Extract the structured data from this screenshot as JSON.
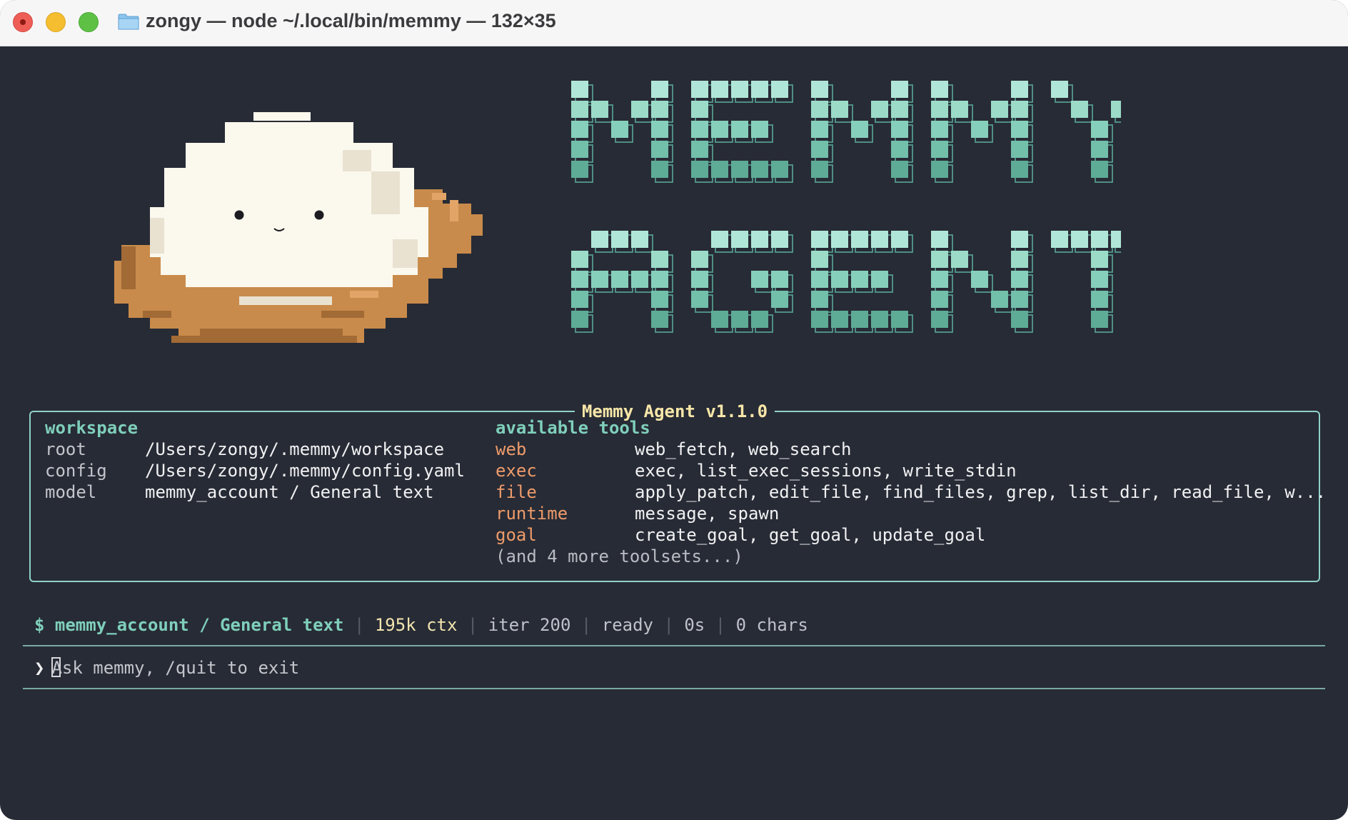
{
  "window": {
    "title": "zongy — node ~/.local/bin/memmy — 132×35"
  },
  "banner": {
    "logo_line_1": "MEMMY",
    "logo_line_2": "AGENT",
    "logo_color": "#9ee0cd"
  },
  "info_panel": {
    "title": "Memmy Agent v1.1.0",
    "workspace": {
      "heading": "workspace",
      "rows": [
        {
          "label": "root",
          "value": "/Users/zongy/.memmy/workspace"
        },
        {
          "label": "config",
          "value": "/Users/zongy/.memmy/config.yaml"
        },
        {
          "label": "model",
          "value": "memmy_account / General text"
        }
      ]
    },
    "tools": {
      "heading": "available tools",
      "rows": [
        {
          "category": "web",
          "tools": "web_fetch, web_search"
        },
        {
          "category": "exec",
          "tools": "exec, list_exec_sessions, write_stdin"
        },
        {
          "category": "file",
          "tools": "apply_patch, edit_file, find_files, grep, list_dir, read_file, w..."
        },
        {
          "category": "runtime",
          "tools": "message, spawn"
        },
        {
          "category": "goal",
          "tools": "create_goal, get_goal, update_goal"
        }
      ],
      "more": "(and 4 more toolsets...)"
    }
  },
  "status_bar": {
    "model": "$ memmy_account / General text",
    "separator": "|",
    "context": "195k ctx",
    "iterations": "iter 200",
    "state": "ready",
    "elapsed": "0s",
    "chars": "0 chars"
  },
  "input": {
    "prompt_symbol": "❯",
    "placeholder": "Ask memmy, /quit to exit"
  },
  "colors": {
    "accent_teal": "#7fcfbb",
    "category_orange": "#ee9b6a",
    "version_yellow": "#f7e6a8",
    "terminal_bg": "#272b35"
  }
}
